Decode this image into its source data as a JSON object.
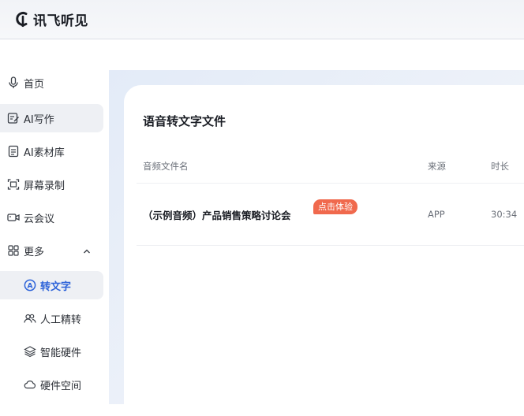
{
  "app": {
    "name": "讯飞听见"
  },
  "sidebar": {
    "items": [
      {
        "label": "首页",
        "icon": "microphone-icon"
      },
      {
        "label": "AI写作",
        "icon": "edit-icon"
      },
      {
        "label": "AI素材库",
        "icon": "document-icon"
      },
      {
        "label": "屏幕录制",
        "icon": "screen-record-icon"
      },
      {
        "label": "云会议",
        "icon": "video-icon"
      },
      {
        "label": "更多",
        "icon": "grid-icon"
      }
    ],
    "more_expanded": true,
    "sub_items": [
      {
        "label": "转文字",
        "icon": "transcribe-icon",
        "active": true
      },
      {
        "label": "人工精转",
        "icon": "people-icon"
      },
      {
        "label": "智能硬件",
        "icon": "layers-icon"
      },
      {
        "label": "硬件空间",
        "icon": "cloud-icon"
      }
    ]
  },
  "main": {
    "title": "语音转文字文件",
    "columns": {
      "name": "音频文件名",
      "source": "来源",
      "duration": "时长"
    },
    "rows": [
      {
        "name": "（示例音频）产品销售策略讨论会",
        "badge": "点击体验",
        "source": "APP",
        "duration": "30:34"
      }
    ]
  },
  "colors": {
    "accent": "#2d63d9",
    "badge": "#f0694d",
    "active_bg": "#eef0f4"
  }
}
